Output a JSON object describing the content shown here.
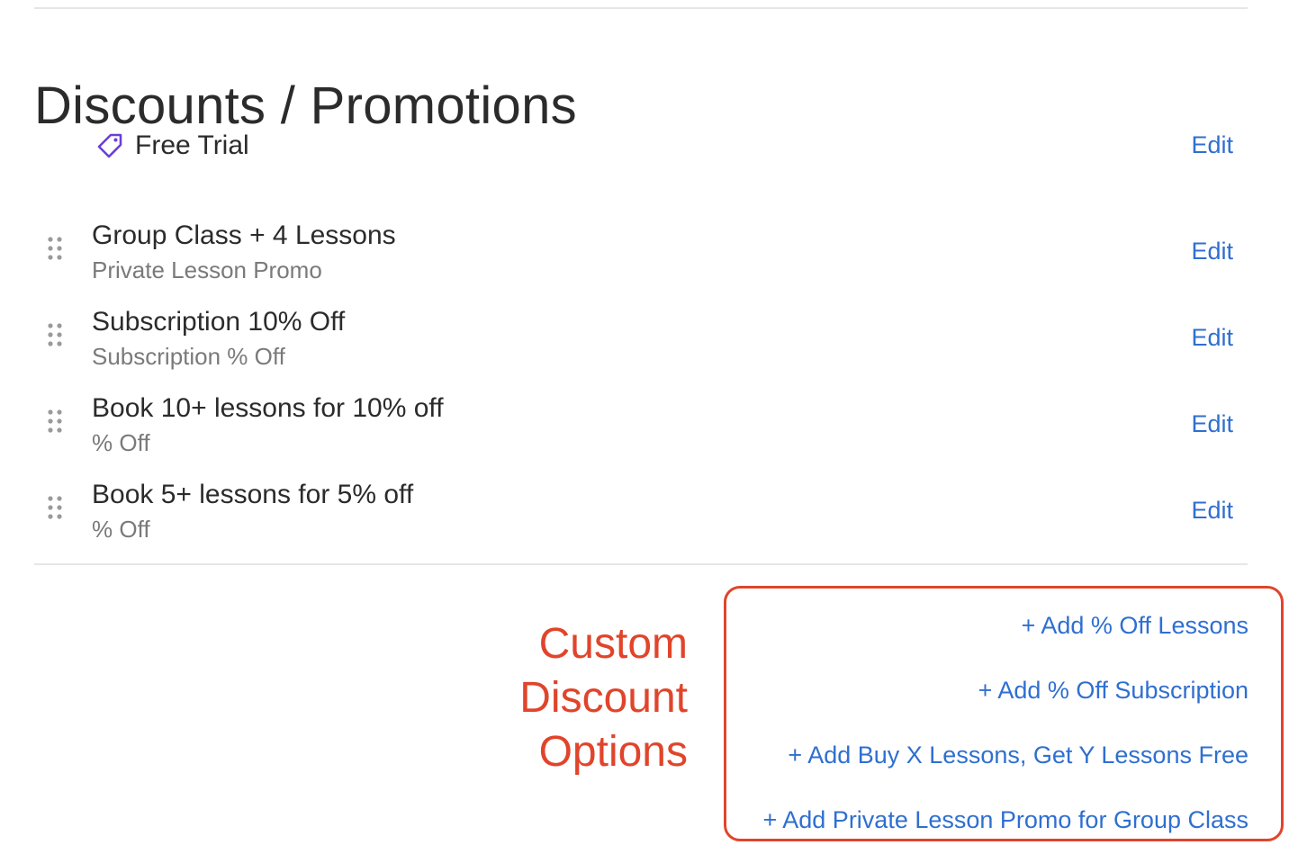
{
  "page": {
    "title": "Discounts / Promotions"
  },
  "free_trial": {
    "label": "Free Trial",
    "edit_label": "Edit",
    "icon": "tag-icon"
  },
  "promotions": [
    {
      "title": "Group Class + 4 Lessons",
      "subtitle": "Private Lesson Promo",
      "edit_label": "Edit"
    },
    {
      "title": "Subscription 10% Off",
      "subtitle": "Subscription % Off",
      "edit_label": "Edit"
    },
    {
      "title": "Book 10+ lessons for 10% off",
      "subtitle": "% Off",
      "edit_label": "Edit"
    },
    {
      "title": "Book 5+ lessons for 5% off",
      "subtitle": "% Off",
      "edit_label": "Edit"
    }
  ],
  "annotation": {
    "line1": "Custom",
    "line2": "Discount",
    "line3": "Options"
  },
  "add_options": [
    {
      "plus": "+",
      "label": "Add % Off Lessons"
    },
    {
      "plus": "+",
      "label": "Add % Off Subscription"
    },
    {
      "plus": "+",
      "label": "Add Buy X Lessons, Get Y Lessons Free"
    },
    {
      "plus": "+",
      "label": "Add Private Lesson Promo for Group Class"
    }
  ],
  "colors": {
    "link": "#2f6fd0",
    "annotation": "#e0452b",
    "tag_icon": "#6b3fd6",
    "subtitle": "#7a7a7a"
  }
}
